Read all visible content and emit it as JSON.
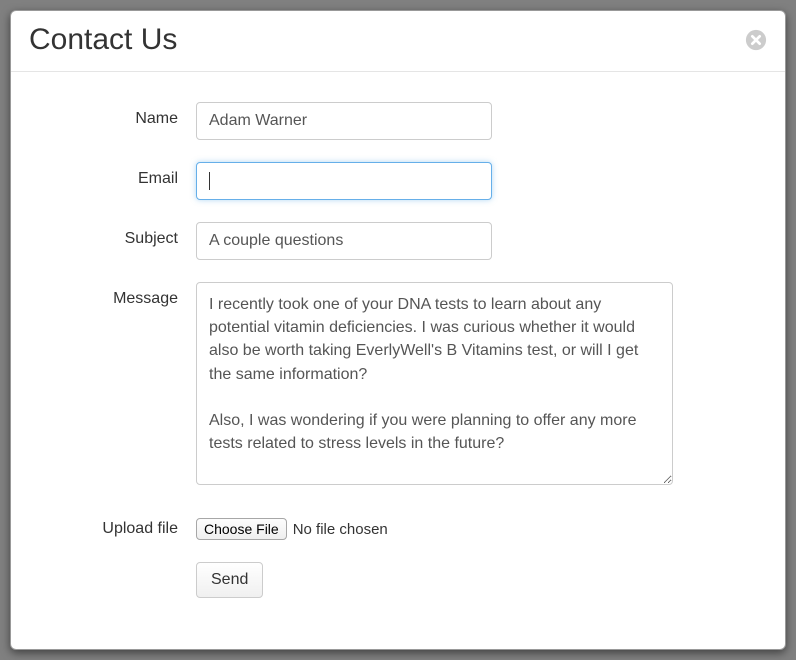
{
  "modal": {
    "title": "Contact Us"
  },
  "form": {
    "labels": {
      "name": "Name",
      "email": "Email",
      "subject": "Subject",
      "message": "Message",
      "upload": "Upload file"
    },
    "values": {
      "name": "Adam Warner",
      "email": "",
      "subject": "A couple questions",
      "message": "I recently took one of your DNA tests to learn about any potential vitamin deficiencies. I was curious whether it would also be worth taking EverlyWell's B Vitamins test, or will I get the same information?\n\nAlso, I was wondering if you were planning to offer any more tests related to stress levels in the future?"
    },
    "file": {
      "button": "Choose File",
      "status": "No file chosen"
    },
    "submit": "Send"
  }
}
